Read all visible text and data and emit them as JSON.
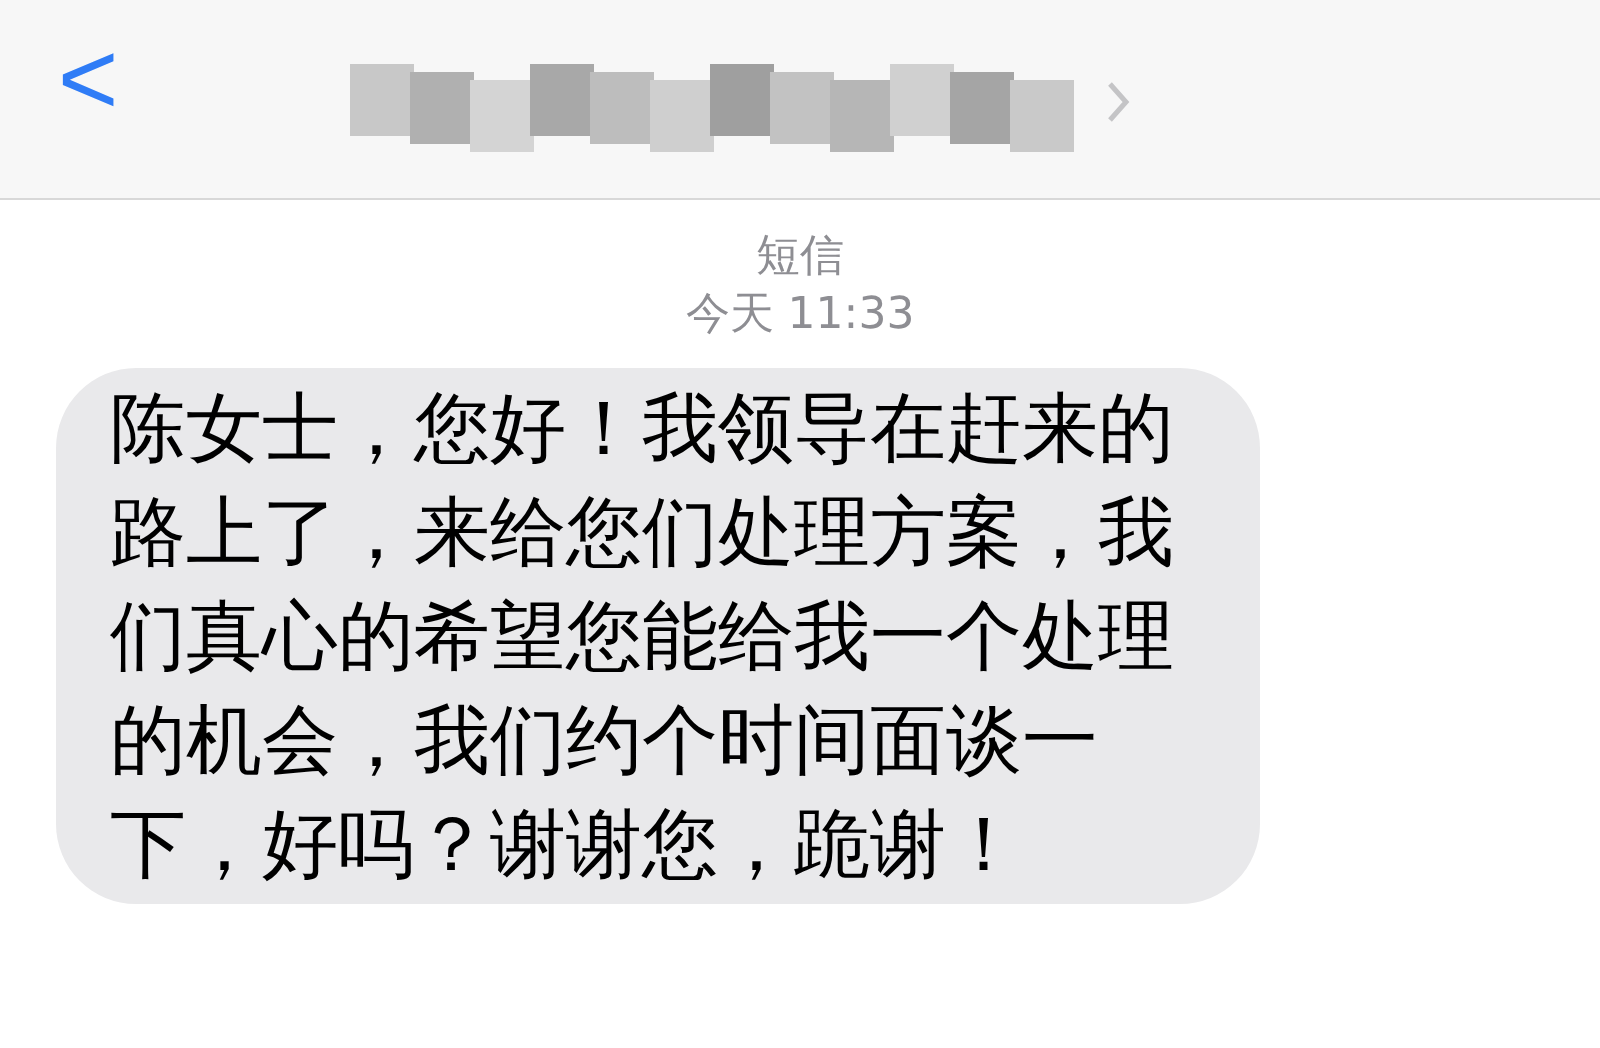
{
  "header": {
    "back_icon": "<"
  },
  "service": "短信",
  "timestamp": "今天 11:33",
  "messages": [
    {
      "text": "陈女士，您好！我领导在赶来的路上了，来给您们处理方案，我们真心的希望您能给我一个处理的机会，我们约个时间面谈一下，好吗？谢谢您，跪谢！",
      "incoming": true
    }
  ]
}
